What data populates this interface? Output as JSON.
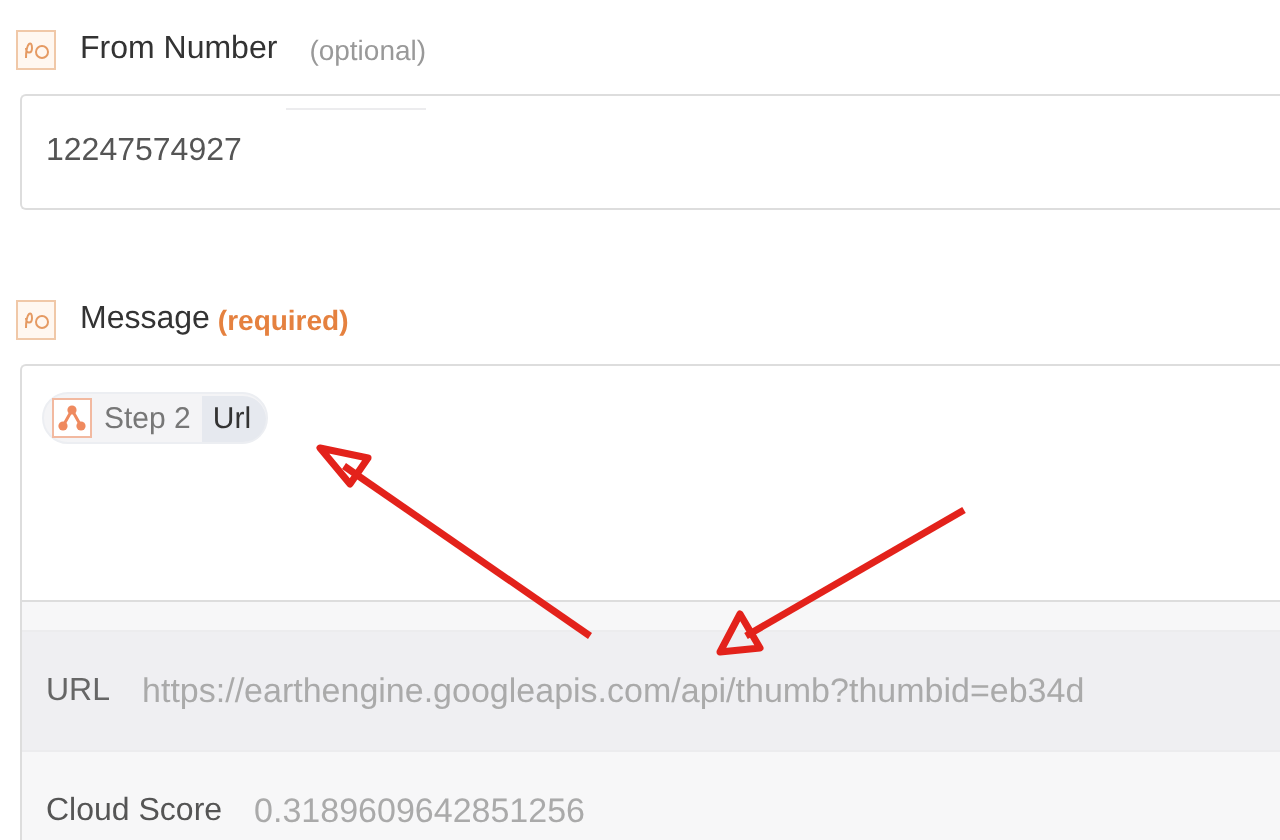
{
  "fields": [
    {
      "label": "From Number",
      "note": "(optional)",
      "kind": "optional",
      "value": "12247574927"
    },
    {
      "label": "Message",
      "note": "(required)",
      "kind": "required",
      "tokens": [
        {
          "step": "Step 2",
          "field": "Url"
        }
      ]
    }
  ],
  "options": [
    {
      "label": "URL",
      "value": "https://earthengine.googleapis.com/api/thumb?thumbid=eb34d",
      "selected": true
    },
    {
      "label": "Cloud Score",
      "value": "0.3189609642851256",
      "selected": false
    }
  ]
}
